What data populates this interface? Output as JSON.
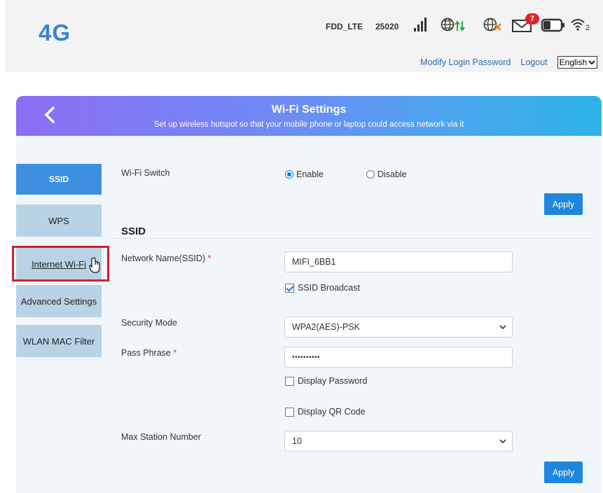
{
  "header": {
    "logo": "4G",
    "network_type": "FDD_LTE",
    "network_code": "25020",
    "message_count": "7",
    "wifi_clients": "2",
    "links": {
      "modify_password": "Modify Login Password",
      "logout": "Logout"
    },
    "language": "English"
  },
  "banner": {
    "title": "Wi-Fi Settings",
    "subtitle": "Set up wireless hotspot so that your mobile phone or laptop could access network via it"
  },
  "menu": {
    "items": [
      {
        "label": "SSID"
      },
      {
        "label": "WPS"
      },
      {
        "label": "Internet Wi-Fi"
      },
      {
        "label": "Advanced Settings"
      },
      {
        "label": "WLAN MAC Filter"
      }
    ]
  },
  "form": {
    "wifi_switch_label": "Wi-Fi Switch",
    "enable_label": "Enable",
    "disable_label": "Disable",
    "apply_label": "Apply",
    "section_title": "SSID",
    "ssid_label": "Network Name(SSID)",
    "required_mark": "*",
    "ssid_value": "MIFI_6BB1",
    "ssid_broadcast_label": "SSID Broadcast",
    "security_label": "Security Mode",
    "security_value": "WPA2(AES)-PSK",
    "pass_label": "Pass Phrase",
    "pass_value": "••••••••••",
    "display_password_label": "Display Password",
    "display_qr_label": "Display QR Code",
    "max_station_label": "Max Station Number",
    "max_station_value": "10"
  },
  "colors": {
    "accent": "#1f86dd",
    "menu_active": "#3d8fe0",
    "menu_inactive": "#b8d3e4",
    "highlight_frame": "#d81f26",
    "message_badge": "#e02424"
  },
  "icons": [
    "signal-bars-icon",
    "globe-data-icon",
    "globe-roaming-off-icon",
    "envelope-icon",
    "battery-icon",
    "wifi-icon",
    "back-arrow-icon",
    "hand-cursor-icon",
    "chevron-down-icon"
  ]
}
